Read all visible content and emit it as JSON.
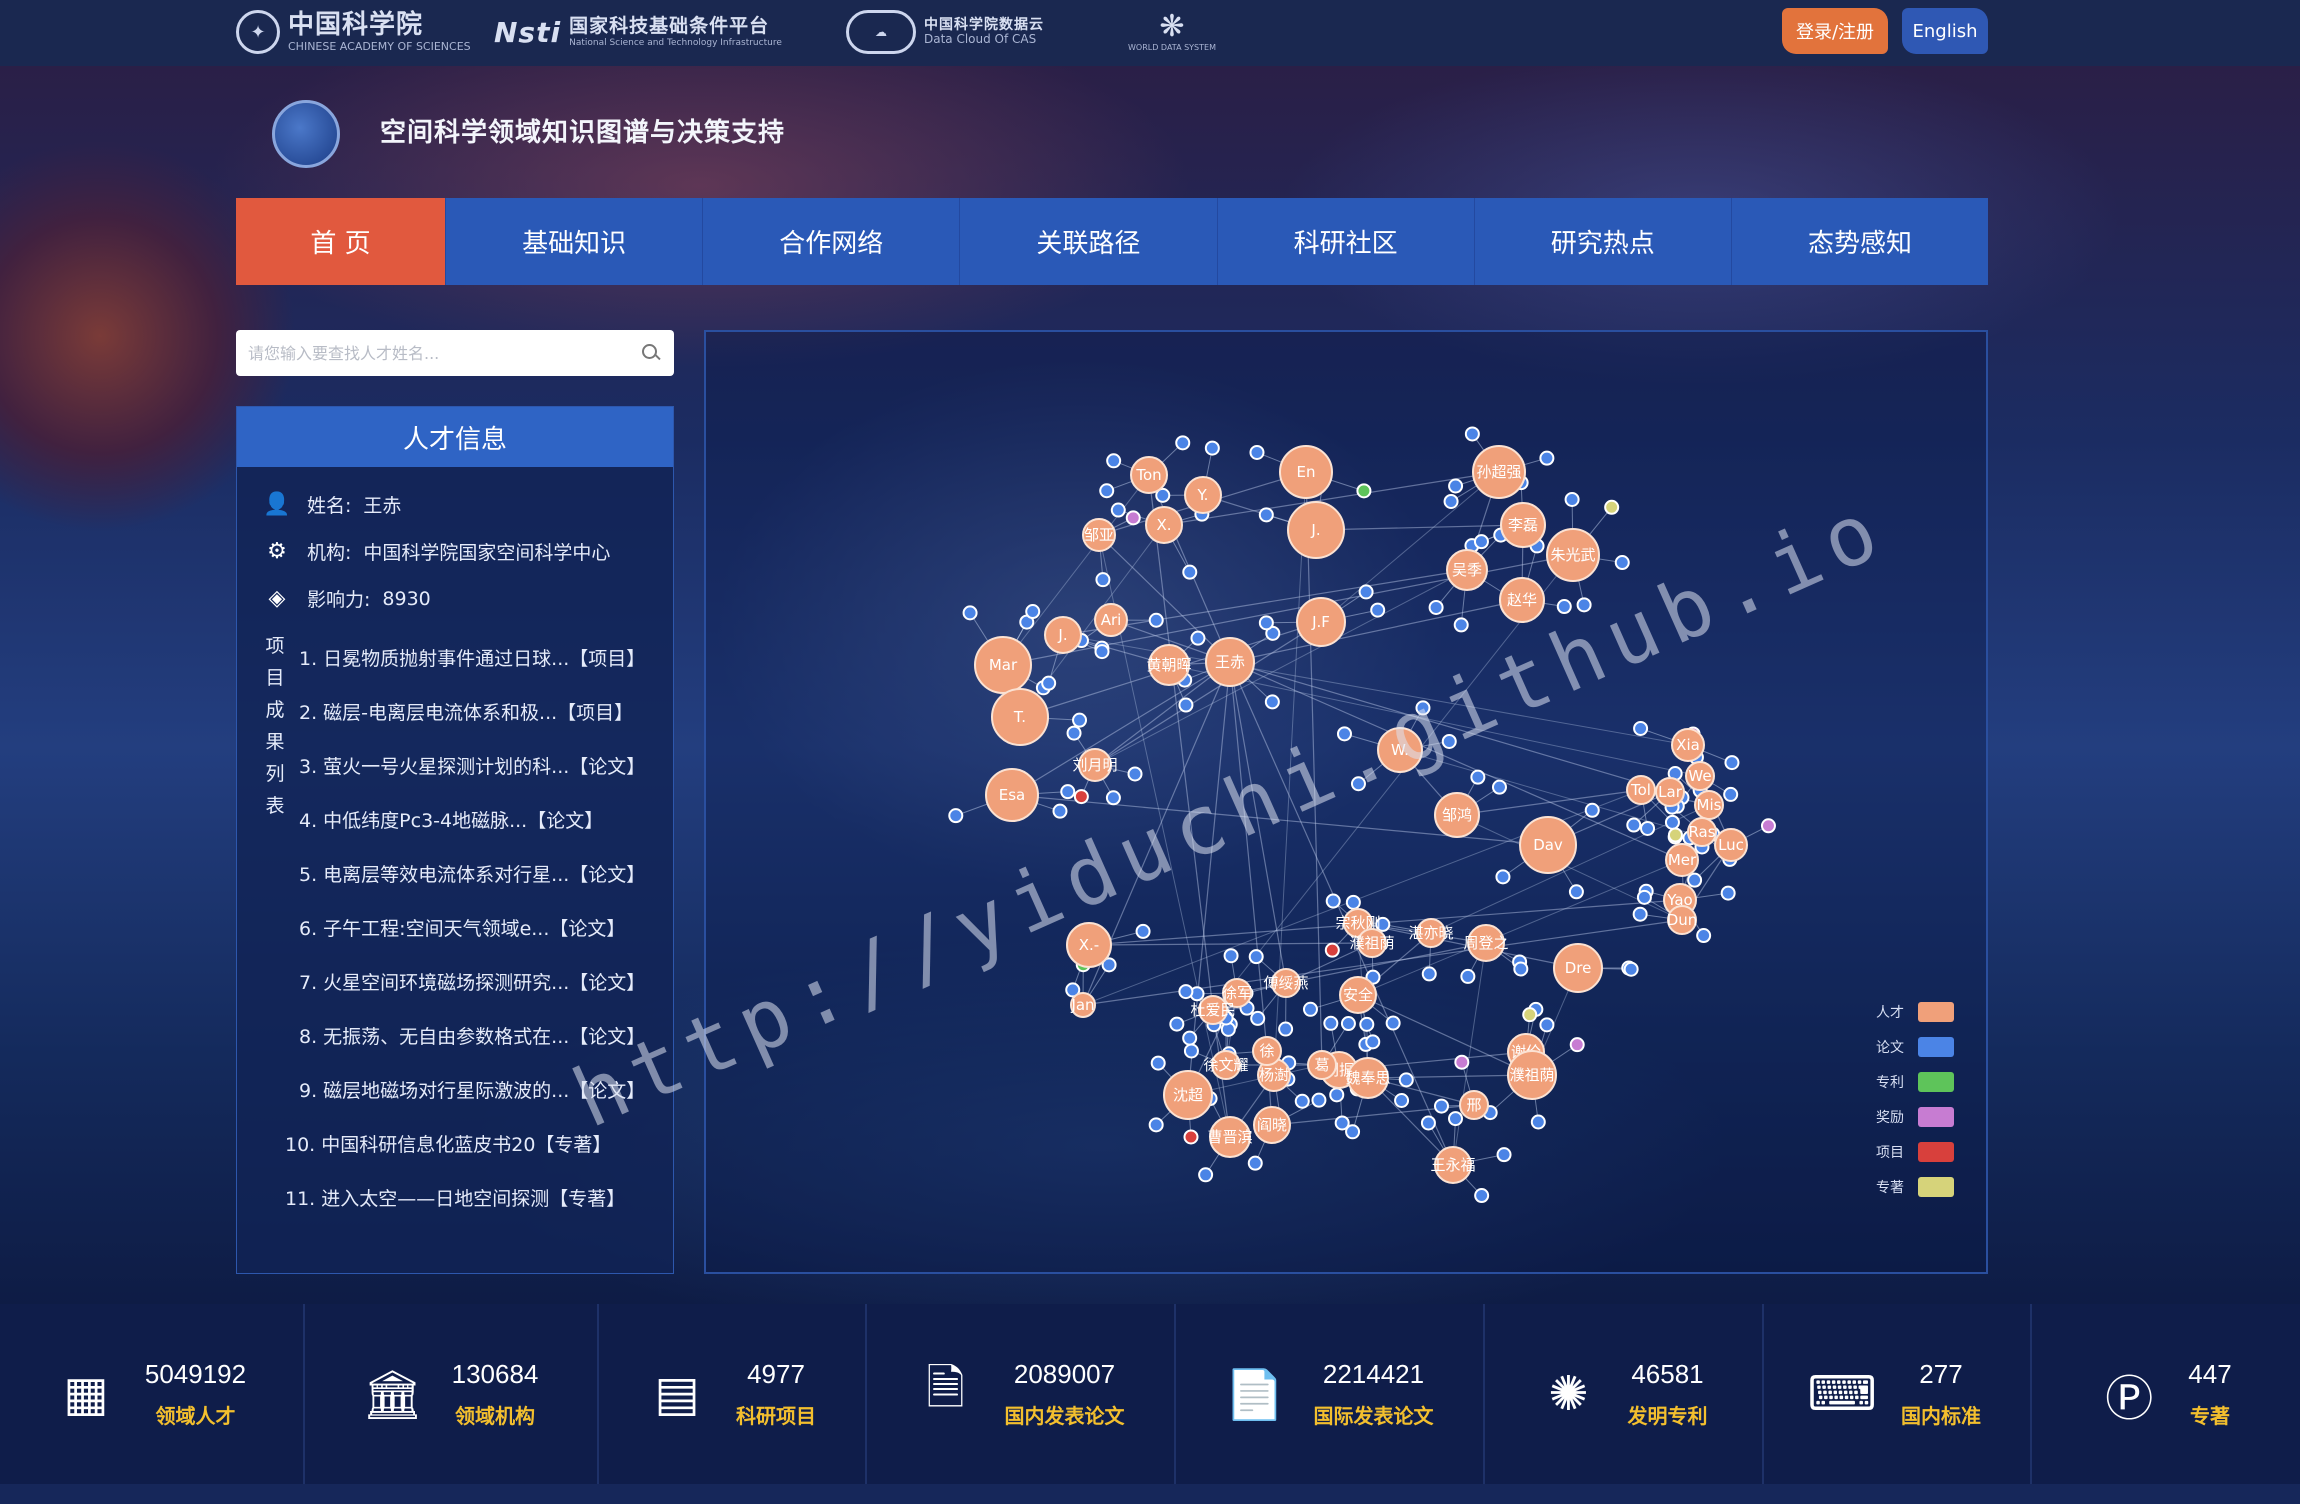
{
  "header": {
    "logos": [
      {
        "icon": "cas-emblem",
        "main": "中国科学院",
        "sub": "CHINESE ACADEMY OF SCIENCES"
      },
      {
        "icon": "nsti-logo",
        "main": "国家科技基础条件平台",
        "sub": "National Science and Technology Infrastructure"
      },
      {
        "icon": "data-cloud-logo",
        "main": "中国科学院数据云",
        "sub": "Data Cloud Of CAS"
      },
      {
        "icon": "world-data-system-logo",
        "main": "",
        "sub": "WORLD DATA SYSTEM"
      }
    ],
    "login_label": "登录/注册",
    "english_label": "English"
  },
  "site": {
    "title": "空间科学领域知识图谱与决策支持"
  },
  "nav": {
    "items": [
      "首 页",
      "基础知识",
      "合作网络",
      "关联路径",
      "科研社区",
      "研究热点",
      "态势感知"
    ],
    "active": "首 页"
  },
  "search": {
    "placeholder": "请您输入要查找人才姓名..."
  },
  "talent": {
    "title": "人才信息",
    "name_label": "姓名:",
    "name": "王赤",
    "org_label": "机构:",
    "org": "中国科学院国家空间科学中心",
    "influence_label": "影响力:",
    "influence": "8930",
    "results_label": "项目成果列表",
    "results": [
      "1. 日冕物质抛射事件通过日球...【项目】",
      "2. 磁层-电离层电流体系和极...【项目】",
      "3. 萤火一号火星探测计划的科...【论文】",
      "4. 中低纬度Pc3-4地磁脉...【论文】",
      "5. 电离层等效电流体系对行星...【论文】",
      "6. 子午工程:空间天气领域e...【论文】",
      "7. 火星空间环境磁场探测研究...【论文】",
      "8. 无振荡、无自由参数格式在...【论文】",
      "9. 磁层地磁场对行星际激波的...【论文】",
      "10. 中国科研信息化蓝皮书20【专著】",
      "11. 进入太空——日地空间探测【专著】"
    ]
  },
  "graph": {
    "legend": [
      {
        "label": "人才",
        "color": "#f0a07a"
      },
      {
        "label": "论文",
        "color": "#4b84e6"
      },
      {
        "label": "专利",
        "color": "#5ec45a"
      },
      {
        "label": "奖励",
        "color": "#c77cd2"
      },
      {
        "label": "项目",
        "color": "#d8403c"
      },
      {
        "label": "专著",
        "color": "#d6d37a"
      }
    ],
    "node_labels": [
      "Ton",
      "Y.",
      "En",
      "X.",
      "J.",
      "邹亚",
      "孙超强",
      "李磊",
      "朱光武",
      "吴季",
      "赵华",
      "Mar",
      "J.",
      "Ari",
      "T.",
      "黄朝晖",
      "王赤",
      "J.F",
      "W.",
      "Esa",
      "刘月明",
      "邹鸿",
      "Dav",
      "Xia",
      "Tol",
      "Lar",
      "We",
      "Mis",
      "Ras",
      "Luc",
      "Mer",
      "Yao",
      "Dun",
      "Dre",
      "X.-",
      "Jan",
      "宗秋刚",
      "濮祖荫",
      "湛亦晓",
      "周登之",
      "傅绥燕",
      "安全",
      "徐军",
      "谢伦",
      "濮祖荫",
      "沈超",
      "刘振",
      "魏奉思",
      "杨澍",
      "邢",
      "王永福",
      "曹晋滨",
      "阎晓",
      "徐文耀",
      "杜爱民",
      "徐",
      "葛"
    ]
  },
  "watermark": "http://yiduchi.github.io",
  "stats": [
    {
      "icon": "grid-icon",
      "value": "5049192",
      "label": "领域人才"
    },
    {
      "icon": "institution-icon",
      "value": "130684",
      "label": "领域机构"
    },
    {
      "icon": "folder-icon",
      "value": "4977",
      "label": "科研项目"
    },
    {
      "icon": "document-icon",
      "value": "2089007",
      "label": "国内发表论文"
    },
    {
      "icon": "paper-icon",
      "value": "2214421",
      "label": "国际发表论文"
    },
    {
      "icon": "patent-icon",
      "value": "46581",
      "label": "发明专利"
    },
    {
      "icon": "standard-icon",
      "value": "277",
      "label": "国内标准"
    },
    {
      "icon": "monograph-icon",
      "value": "447",
      "label": "专著"
    }
  ]
}
